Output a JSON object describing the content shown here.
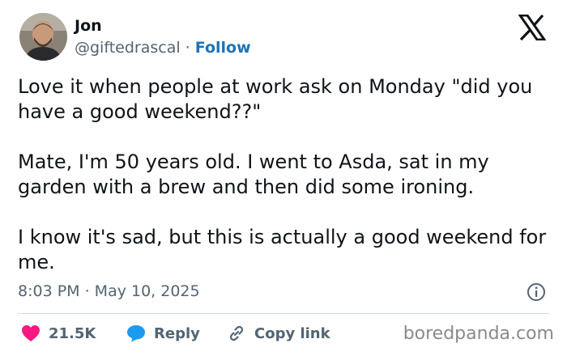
{
  "author": {
    "name": "Jon",
    "handle": "@giftedrascal",
    "separator": "·",
    "follow_label": "Follow"
  },
  "tweet": {
    "paragraphs": [
      "Love it when people at work ask on Monday \"did you have a good weekend??\"",
      "Mate, I'm 50 years old. I went to Asda, sat in my garden with a brew and then did some ironing.",
      "I know it's sad, but this is actually a good weekend for me."
    ],
    "timestamp": "8:03 PM · May 10, 2025"
  },
  "actions": {
    "likes": "21.5K",
    "reply_label": "Reply",
    "copy_link_label": "Copy link"
  },
  "watermark": "boredpanda.com",
  "icons": {
    "platform": "x-logo-icon",
    "like": "heart-icon",
    "reply": "speech-bubble-icon",
    "copy_link": "link-icon",
    "info": "info-icon"
  },
  "colors": {
    "like": "#f91880",
    "reply": "#1d9bf0",
    "follow": "#1d72b8",
    "muted": "#536471"
  }
}
